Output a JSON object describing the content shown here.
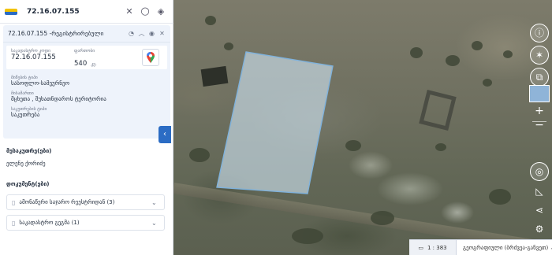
{
  "search": {
    "value": "72.16.07.155"
  },
  "card": {
    "cadastral_code": "72.16.07.155",
    "status": "-რეგისტრირებული",
    "code_label": "საკადასტრო კოდი",
    "code_value": "72.16.07.155",
    "area_label": "ფართობი",
    "area_value": "540",
    "area_unit": "კვ.",
    "category_label": "მიწების ტიპი",
    "category_value": "სასოფლო-სამეურნეო",
    "address_label": "მისამართი",
    "address_value": "მცხეთა , შუხათნდაროს ტერიტორია",
    "purpose_label": "საკუთრების ტიპი",
    "purpose_value": "საკუთრება"
  },
  "owner": {
    "heading": "მესაკუთრე(ები)",
    "value": "ელენე ქორიძე"
  },
  "docs": {
    "heading": "დოკუმენტ(ები)",
    "items": [
      {
        "label": "ამონაწერი საჯარო რეესტრიდან (3)"
      },
      {
        "label": "საკადასტრო გეგმა (1)"
      }
    ]
  },
  "map": {
    "scale": "1 : 383",
    "layer": "გეოგრაფიული (ბრძვეა-განვეთ)"
  },
  "icons": [
    "logo-icon",
    "close-icon",
    "search-icon",
    "layers-icon",
    "settings-icon",
    "chevron-up-icon",
    "eye-icon",
    "close-icon",
    "google-maps-icon",
    "chevron-left-icon",
    "document-icon",
    "chevron-down-icon",
    "info-icon",
    "compass-icon",
    "plus-icon",
    "minus-icon",
    "location-icon",
    "share-icon"
  ],
  "colors": {
    "accent": "#2b6cc4",
    "parcel_fill": "#cfe3f2",
    "parcel_stroke": "#7fb2dc"
  }
}
